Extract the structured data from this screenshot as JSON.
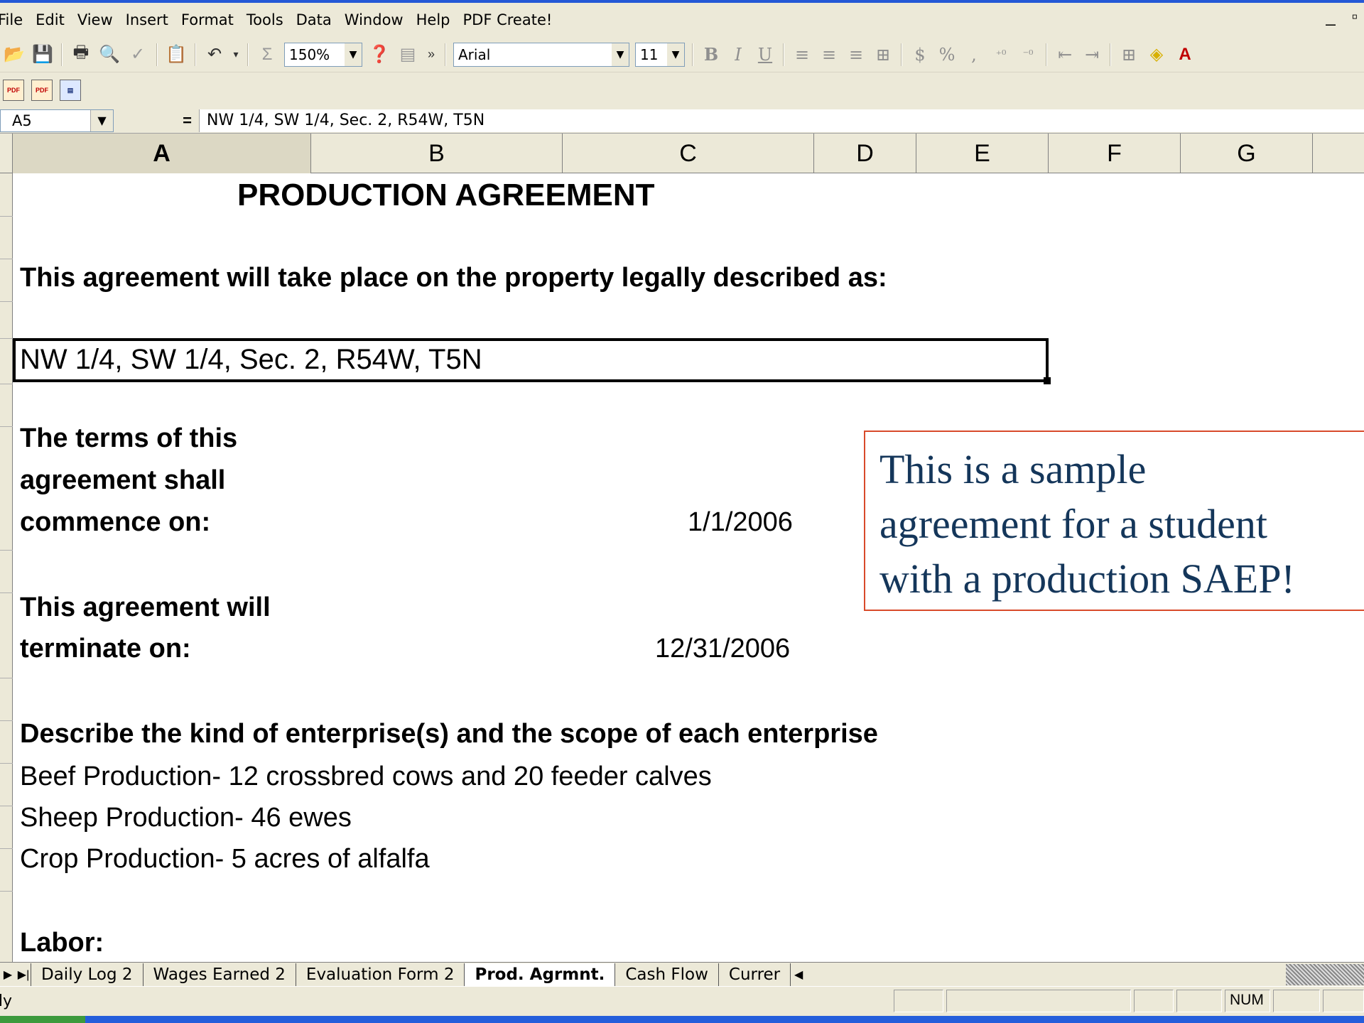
{
  "menu": [
    "File",
    "Edit",
    "View",
    "Insert",
    "Format",
    "Tools",
    "Data",
    "Window",
    "Help",
    "PDF Create!"
  ],
  "toolbar": {
    "zoom": "150%",
    "font": "Arial",
    "font_size": "11"
  },
  "formula_bar": {
    "name_box": "A5",
    "equals": "=",
    "formula": "NW 1/4, SW 1/4, Sec. 2, R54W, T5N"
  },
  "columns": [
    "A",
    "B",
    "C",
    "D",
    "E",
    "F",
    "G"
  ],
  "sheet": {
    "title": "PRODUCTION AGREEMENT",
    "property_prompt": "This agreement will take place on the property legally described as:",
    "property_value": "NW 1/4, SW 1/4, Sec. 2, R54W, T5N",
    "commence_label": [
      "The terms of this",
      "agreement shall",
      "commence on:"
    ],
    "commence_date": "1/1/2006",
    "terminate_label": [
      "This agreement will",
      "terminate on:"
    ],
    "terminate_date": "12/31/2006",
    "enterprise_prompt": "Describe the kind of enterprise(s) and the scope of each enterprise",
    "enterprises": [
      "Beef Production- 12 crossbred cows and 20 feeder calves",
      "Sheep Production- 46 ewes",
      "Crop Production- 5 acres of alfalfa"
    ],
    "labor_label": "Labor:"
  },
  "callout": {
    "lines": [
      "This is a sample",
      "agreement for a student",
      "with a production SAEP!"
    ]
  },
  "sheet_tabs": [
    "Daily Log 2",
    "Wages Earned 2",
    "Evaluation Form 2",
    "Prod. Agrmnt.",
    "Cash Flow",
    "Currer"
  ],
  "active_tab": "Prod. Agrmnt.",
  "status": {
    "ready": "dy",
    "num": "NUM"
  }
}
